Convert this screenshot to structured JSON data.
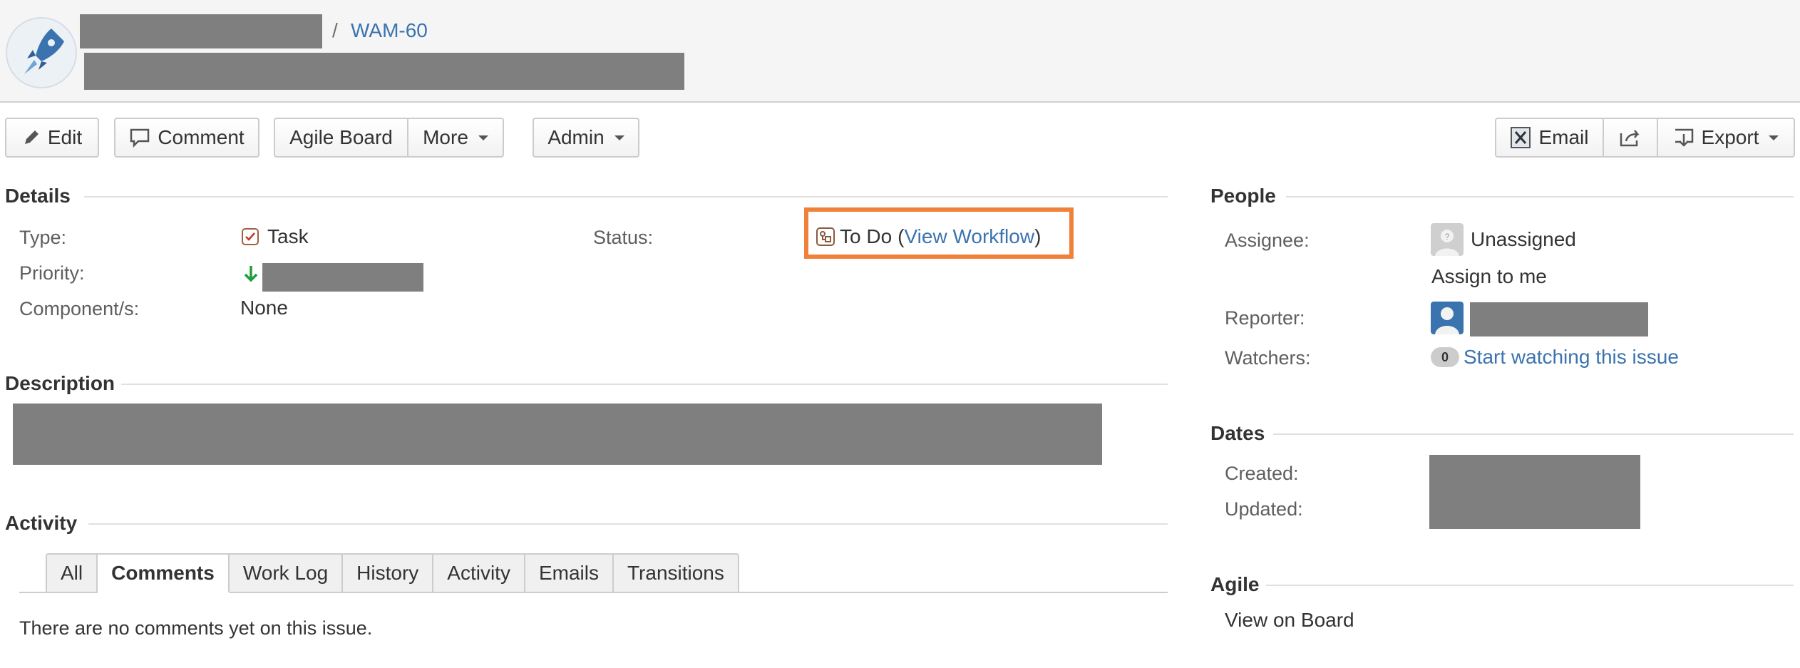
{
  "header": {
    "breadcrumb_separator": "/",
    "issue_key": "WAM-60"
  },
  "toolbar": {
    "edit": "Edit",
    "comment": "Comment",
    "agile_board": "Agile Board",
    "more": "More",
    "admin": "Admin",
    "email": "Email",
    "export": "Export"
  },
  "details": {
    "heading": "Details",
    "type_label": "Type:",
    "type_value": "Task",
    "priority_label": "Priority:",
    "components_label": "Component/s:",
    "components_value": "None",
    "status_label": "Status:",
    "status_value": "To Do",
    "view_workflow": "View Workflow",
    "paren_open": "(",
    "paren_close": ")"
  },
  "description": {
    "heading": "Description"
  },
  "activity": {
    "heading": "Activity",
    "tabs": [
      "All",
      "Comments",
      "Work Log",
      "History",
      "Activity",
      "Emails",
      "Transitions"
    ],
    "active_tab": "Comments",
    "empty_message": "There are no comments yet on this issue."
  },
  "people": {
    "heading": "People",
    "assignee_label": "Assignee:",
    "assignee_value": "Unassigned",
    "assign_to_me": "Assign to me",
    "reporter_label": "Reporter:",
    "watchers_label": "Watchers:",
    "watchers_count": "0",
    "start_watching": "Start watching this issue"
  },
  "dates": {
    "heading": "Dates",
    "created_label": "Created:",
    "updated_label": "Updated:"
  },
  "agile": {
    "heading": "Agile",
    "view_on_board": "View on Board"
  },
  "colors": {
    "link": "#3b73af",
    "highlight": "#f0813a",
    "redaction": "#7f7f7f",
    "priority_arrow": "#1e9e3e"
  }
}
